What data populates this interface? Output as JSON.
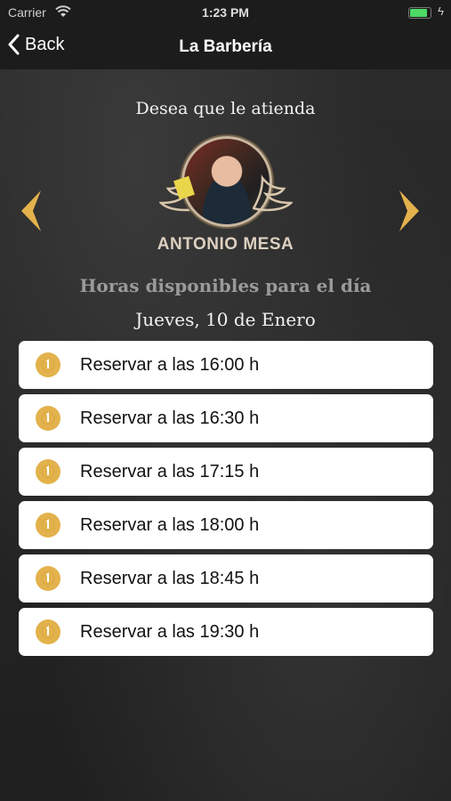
{
  "status_bar": {
    "carrier": "Carrier",
    "time": "1:23 PM",
    "battery_level": 0.85
  },
  "nav": {
    "back_label": "Back",
    "title": "La Barbería"
  },
  "header": {
    "prompt": "Desea que le atienda",
    "barber_name": "ANTONIO MESA"
  },
  "availability": {
    "title": "Horas disponibles para el día",
    "date": "Jueves, 10 de Enero",
    "slots": [
      {
        "label": "Reservar a las 16:00 h"
      },
      {
        "label": "Reservar a las 16:30 h"
      },
      {
        "label": "Reservar a las 17:15 h"
      },
      {
        "label": "Reservar a las 18:00 h"
      },
      {
        "label": "Reservar a las 18:45 h"
      },
      {
        "label": "Reservar a las 19:30 h"
      }
    ]
  },
  "icons": {
    "back": "chevron-left-icon",
    "prev": "arrow-left-icon",
    "next": "arrow-right-icon",
    "slot": "clock-icon",
    "wifi": "wifi-icon",
    "battery": "battery-icon"
  },
  "colors": {
    "accent_gold": "#e3b24c",
    "name_color": "#ddd0c0",
    "battery_green": "#4cd964"
  }
}
